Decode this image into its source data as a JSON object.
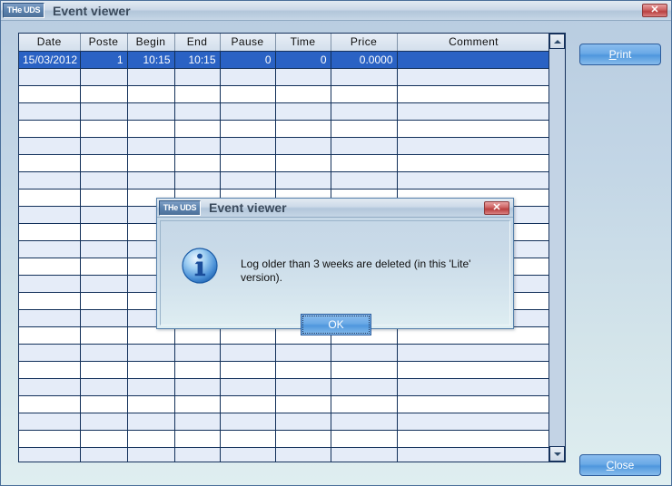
{
  "window": {
    "app_badge": "THe UDS",
    "title": "Event viewer",
    "close_label": "✕"
  },
  "grid": {
    "columns": [
      "Date",
      "Poste",
      "Begin",
      "End",
      "Pause",
      "Time",
      "Price",
      "Comment"
    ],
    "rows": [
      {
        "selected": true,
        "cells": [
          "15/03/2012",
          "1",
          "10:15",
          "10:15",
          "0",
          "0",
          "0.0000",
          ""
        ]
      }
    ],
    "empty_row_count": 23,
    "scrollbar": {
      "up_arrow": "scroll-up-arrow",
      "down_arrow": "scroll-down-arrow"
    }
  },
  "buttons": {
    "print": {
      "accel": "P",
      "rest": "rint"
    },
    "close": {
      "accel": "C",
      "rest": "lose"
    }
  },
  "dialog": {
    "app_badge": "THe UDS",
    "title": "Event viewer",
    "close_label": "✕",
    "message": "Log older than 3 weeks are deleted (in this 'Lite' version).",
    "ok_label": "OK",
    "icon": "info-icon"
  },
  "colors": {
    "accent_blue": "#4f97dd",
    "selection_blue": "#2a62c4",
    "title_text": "#3a4a5c",
    "close_red": "#b94040",
    "row_alt": "#e5ecf8"
  }
}
